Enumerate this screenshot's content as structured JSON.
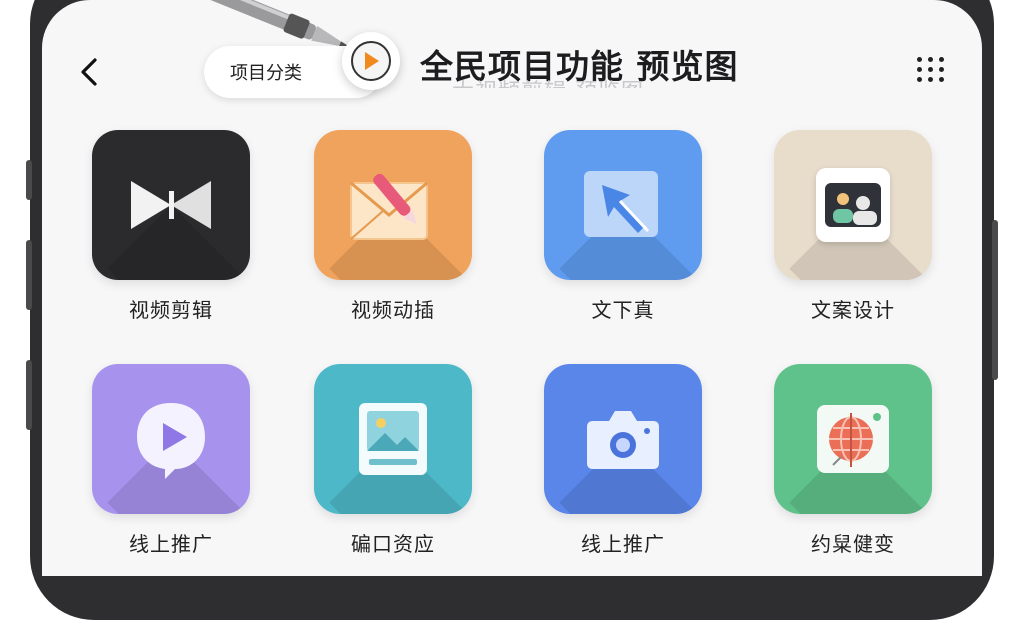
{
  "header": {
    "back_icon": "chevron-left-icon",
    "category_label": "项目分类",
    "play_icon": "play-icon",
    "title": "全民项目功能 预览图",
    "title_ghost": "大视频剪辑 预览图",
    "more_icon": "grid-dots-icon"
  },
  "apps": [
    {
      "label": "视频剪辑",
      "icon": "video-edit-icon",
      "bg": "#2b2b2d"
    },
    {
      "label": "视频动插",
      "icon": "envelope-pen-icon",
      "bg": "#f0a35c"
    },
    {
      "label": "文下真",
      "icon": "cursor-arrow-icon",
      "bg": "#5f9cf0"
    },
    {
      "label": "文案设计",
      "icon": "photo-card-icon",
      "bg": "#e8dccb"
    },
    {
      "label": "线上推广",
      "icon": "play-bubble-icon",
      "bg": "#a792ee"
    },
    {
      "label": "碥口资应",
      "icon": "picture-frame-icon",
      "bg": "#4db8c8"
    },
    {
      "label": "线上推广",
      "icon": "camera-icon",
      "bg": "#5a86ea"
    },
    {
      "label": "约䊆健变",
      "icon": "globe-card-icon",
      "bg": "#5fc28a"
    }
  ]
}
